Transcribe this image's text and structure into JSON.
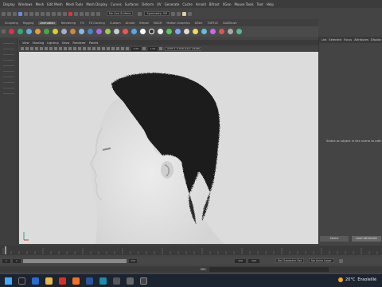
{
  "menubar": {
    "items": [
      "Display",
      "Windows",
      "Mesh",
      "Edit Mesh",
      "Mesh Tools",
      "Mesh Display",
      "Curves",
      "Surfaces",
      "Deform",
      "UV",
      "Generate",
      "Cache",
      "Arnold",
      "Bifrost",
      "XGen",
      "Mouse Tools",
      "Text",
      "Help"
    ]
  },
  "toolrow": {
    "dropdown_surface": "No Live Surface",
    "dropdown_symmetry": "Symmetry: Off"
  },
  "shelf": {
    "tabs": [
      "Sculpting",
      "Rigging",
      "Animation",
      "Rendering",
      "FX",
      "FX Caching",
      "Custom",
      "Arnold",
      "Bifrost",
      "MASH",
      "Motion Graphics",
      "XGen",
      "TURTLE",
      "GoZBrush"
    ],
    "active_index": 2
  },
  "viewport": {
    "menu": [
      "View",
      "Shading",
      "Lighting",
      "Show",
      "Renderer",
      "Panels"
    ],
    "field_a": "0.00",
    "field_b": "1.00",
    "colorspace": "ACES 1.0 SDR-video (sRGB)"
  },
  "rightpanel": {
    "tabs": [
      "List",
      "Selected",
      "Focus",
      "Attributes",
      "Display"
    ],
    "message": "Select an object in the scene to edit.",
    "btn_select": "Select",
    "btn_load": "Load Attributes"
  },
  "range": {
    "start": "1",
    "end": "120",
    "end2": "200",
    "char_set": "No Character Set",
    "anim_layer": "No Anim Layer"
  },
  "cmdline": {
    "lang": "MEL"
  },
  "taskbar": {
    "temp": "20°C",
    "weather": "Ensoleillé"
  },
  "colors": {
    "viewport_bg": "#dcdcdc",
    "hair": "#1a1a1a",
    "accent": "#6b8fd6"
  }
}
